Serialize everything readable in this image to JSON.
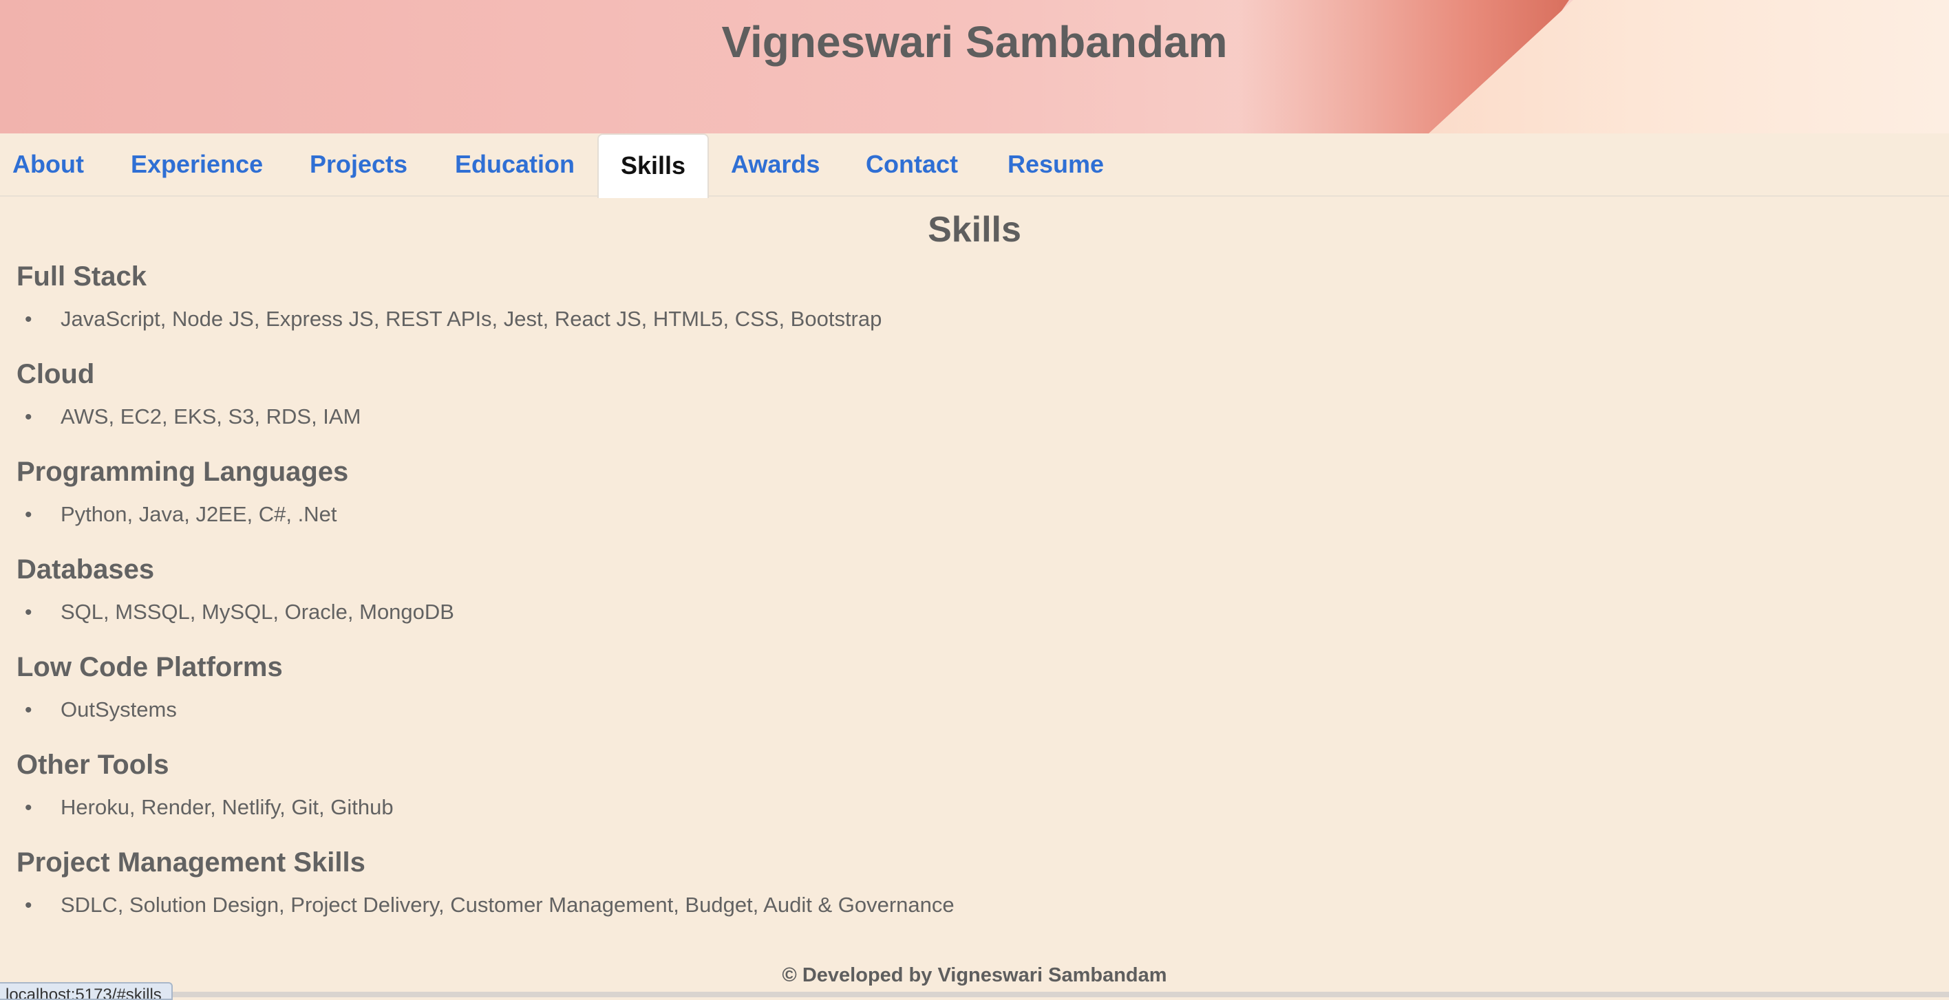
{
  "header": {
    "title": "Vigneswari Sambandam"
  },
  "nav": {
    "tabs": [
      {
        "label": "About"
      },
      {
        "label": "Experience"
      },
      {
        "label": "Projects"
      },
      {
        "label": "Education"
      },
      {
        "label": "Skills",
        "active": true
      },
      {
        "label": "Awards"
      },
      {
        "label": "Contact"
      },
      {
        "label": "Resume"
      }
    ]
  },
  "main": {
    "title": "Skills",
    "sections": [
      {
        "heading": "Full Stack",
        "item": "JavaScript, Node JS, Express JS, REST APIs, Jest, React JS, HTML5, CSS, Bootstrap"
      },
      {
        "heading": "Cloud",
        "item": "AWS, EC2, EKS, S3, RDS, IAM"
      },
      {
        "heading": "Programming Languages",
        "item": "Python, Java, J2EE, C#, .Net"
      },
      {
        "heading": "Databases",
        "item": "SQL, MSSQL, MySQL, Oracle, MongoDB"
      },
      {
        "heading": "Low Code Platforms",
        "item": "OutSystems"
      },
      {
        "heading": "Other Tools",
        "item": "Heroku, Render, Netlify, Git, Github"
      },
      {
        "heading": "Project Management Skills",
        "item": "SDLC, Solution Design, Project Delivery, Customer Management, Budget, Audit & Governance"
      }
    ]
  },
  "footer": {
    "text": "© Developed by Vigneswari Sambandam"
  },
  "status_bar": {
    "url": "localhost:5173/#skills"
  },
  "colors": {
    "background": "#f8ebdb",
    "link": "#2f6fd4",
    "text": "#626262",
    "active_tab_bg": "#ffffff"
  }
}
